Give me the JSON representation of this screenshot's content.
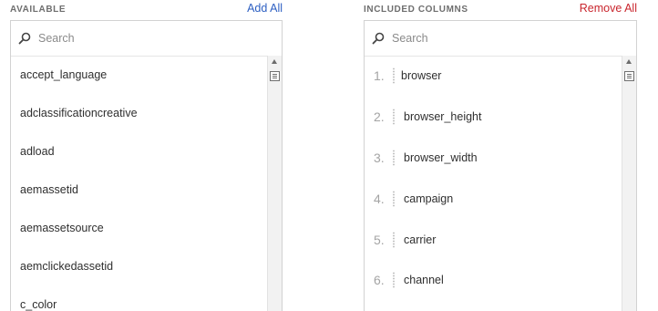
{
  "available": {
    "title": "AVAILABLE",
    "action_label": "Add All",
    "search_placeholder": "Search",
    "items": [
      "accept_language",
      "adclassificationcreative",
      "adload",
      "aemassetid",
      "aemassetsource",
      "aemclickedassetid",
      "c_color"
    ]
  },
  "included": {
    "title": "INCLUDED COLUMNS",
    "action_label": "Remove All",
    "search_placeholder": "Search",
    "items": [
      {
        "num": "1.",
        "label": "browser"
      },
      {
        "num": "2.",
        "label": "browser_height"
      },
      {
        "num": "3.",
        "label": "browser_width"
      },
      {
        "num": "4.",
        "label": "campaign"
      },
      {
        "num": "5.",
        "label": "carrier"
      },
      {
        "num": "6.",
        "label": "channel"
      }
    ]
  },
  "colors": {
    "add_all": "#2d5fc2",
    "remove_all": "#c9252d"
  }
}
